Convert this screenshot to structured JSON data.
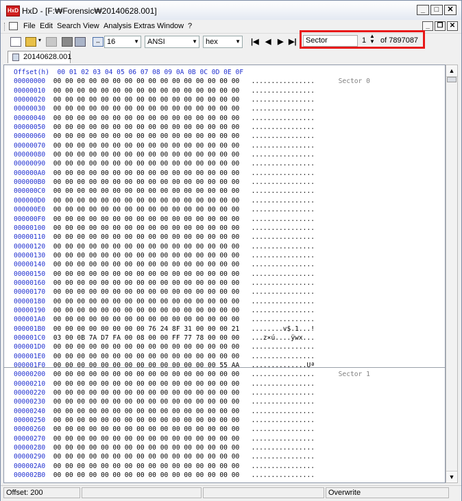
{
  "window": {
    "title": "HxD - [F:₩Forensic₩20140628.001]",
    "app_icon_text": "HxD"
  },
  "menu": [
    "File",
    "Edit",
    "Search",
    "View",
    "Analysis",
    "Extras",
    "Window",
    "?"
  ],
  "toolbar": {
    "bytes_per_row": "16",
    "charset": "ANSI",
    "offset_base": "hex",
    "sector_label": "Sector",
    "sector_value": "1",
    "sector_total": "of 7897087"
  },
  "tab": {
    "label": "20140628.001"
  },
  "hex": {
    "header": "Offset(h)  00 01 02 03 04 05 06 07 08 09 0A 0B 0C 0D 0E 0F",
    "rows": [
      {
        "o": "00000000",
        "b": "00 00 00 00 00 00 00 00 00 00 00 00 00 00 00 00",
        "t": "................",
        "s": "Sector 0"
      },
      {
        "o": "00000010",
        "b": "00 00 00 00 00 00 00 00 00 00 00 00 00 00 00 00",
        "t": "................",
        "s": ""
      },
      {
        "o": "00000020",
        "b": "00 00 00 00 00 00 00 00 00 00 00 00 00 00 00 00",
        "t": "................",
        "s": ""
      },
      {
        "o": "00000030",
        "b": "00 00 00 00 00 00 00 00 00 00 00 00 00 00 00 00",
        "t": "................",
        "s": ""
      },
      {
        "o": "00000040",
        "b": "00 00 00 00 00 00 00 00 00 00 00 00 00 00 00 00",
        "t": "................",
        "s": ""
      },
      {
        "o": "00000050",
        "b": "00 00 00 00 00 00 00 00 00 00 00 00 00 00 00 00",
        "t": "................",
        "s": ""
      },
      {
        "o": "00000060",
        "b": "00 00 00 00 00 00 00 00 00 00 00 00 00 00 00 00",
        "t": "................",
        "s": ""
      },
      {
        "o": "00000070",
        "b": "00 00 00 00 00 00 00 00 00 00 00 00 00 00 00 00",
        "t": "................",
        "s": ""
      },
      {
        "o": "00000080",
        "b": "00 00 00 00 00 00 00 00 00 00 00 00 00 00 00 00",
        "t": "................",
        "s": ""
      },
      {
        "o": "00000090",
        "b": "00 00 00 00 00 00 00 00 00 00 00 00 00 00 00 00",
        "t": "................",
        "s": ""
      },
      {
        "o": "000000A0",
        "b": "00 00 00 00 00 00 00 00 00 00 00 00 00 00 00 00",
        "t": "................",
        "s": ""
      },
      {
        "o": "000000B0",
        "b": "00 00 00 00 00 00 00 00 00 00 00 00 00 00 00 00",
        "t": "................",
        "s": ""
      },
      {
        "o": "000000C0",
        "b": "00 00 00 00 00 00 00 00 00 00 00 00 00 00 00 00",
        "t": "................",
        "s": ""
      },
      {
        "o": "000000D0",
        "b": "00 00 00 00 00 00 00 00 00 00 00 00 00 00 00 00",
        "t": "................",
        "s": ""
      },
      {
        "o": "000000E0",
        "b": "00 00 00 00 00 00 00 00 00 00 00 00 00 00 00 00",
        "t": "................",
        "s": ""
      },
      {
        "o": "000000F0",
        "b": "00 00 00 00 00 00 00 00 00 00 00 00 00 00 00 00",
        "t": "................",
        "s": ""
      },
      {
        "o": "00000100",
        "b": "00 00 00 00 00 00 00 00 00 00 00 00 00 00 00 00",
        "t": "................",
        "s": ""
      },
      {
        "o": "00000110",
        "b": "00 00 00 00 00 00 00 00 00 00 00 00 00 00 00 00",
        "t": "................",
        "s": ""
      },
      {
        "o": "00000120",
        "b": "00 00 00 00 00 00 00 00 00 00 00 00 00 00 00 00",
        "t": "................",
        "s": ""
      },
      {
        "o": "00000130",
        "b": "00 00 00 00 00 00 00 00 00 00 00 00 00 00 00 00",
        "t": "................",
        "s": ""
      },
      {
        "o": "00000140",
        "b": "00 00 00 00 00 00 00 00 00 00 00 00 00 00 00 00",
        "t": "................",
        "s": ""
      },
      {
        "o": "00000150",
        "b": "00 00 00 00 00 00 00 00 00 00 00 00 00 00 00 00",
        "t": "................",
        "s": ""
      },
      {
        "o": "00000160",
        "b": "00 00 00 00 00 00 00 00 00 00 00 00 00 00 00 00",
        "t": "................",
        "s": ""
      },
      {
        "o": "00000170",
        "b": "00 00 00 00 00 00 00 00 00 00 00 00 00 00 00 00",
        "t": "................",
        "s": ""
      },
      {
        "o": "00000180",
        "b": "00 00 00 00 00 00 00 00 00 00 00 00 00 00 00 00",
        "t": "................",
        "s": ""
      },
      {
        "o": "00000190",
        "b": "00 00 00 00 00 00 00 00 00 00 00 00 00 00 00 00",
        "t": "................",
        "s": ""
      },
      {
        "o": "000001A0",
        "b": "00 00 00 00 00 00 00 00 00 00 00 00 00 00 00 00",
        "t": "................",
        "s": ""
      },
      {
        "o": "000001B0",
        "b": "00 00 00 00 00 00 00 00 76 24 8F 31 00 00 00 21",
        "t": "........v$.1...!",
        "s": ""
      },
      {
        "o": "000001C0",
        "b": "03 00 0B 7A D7 FA 00 08 00 00 FF 77 78 00 00 00",
        "t": "...z×ú....ÿwx...",
        "s": ""
      },
      {
        "o": "000001D0",
        "b": "00 00 00 00 00 00 00 00 00 00 00 00 00 00 00 00",
        "t": "................",
        "s": ""
      },
      {
        "o": "000001E0",
        "b": "00 00 00 00 00 00 00 00 00 00 00 00 00 00 00 00",
        "t": "................",
        "s": ""
      },
      {
        "o": "000001F0",
        "b": "00 00 00 00 00 00 00 00 00 00 00 00 00 00 55 AA",
        "t": "..............Uª",
        "s": ""
      },
      {
        "o": "00000200",
        "b": "00 00 00 00 00 00 00 00 00 00 00 00 00 00 00 00",
        "t": "................",
        "s": "Sector 1"
      },
      {
        "o": "00000210",
        "b": "00 00 00 00 00 00 00 00 00 00 00 00 00 00 00 00",
        "t": "................",
        "s": ""
      },
      {
        "o": "00000220",
        "b": "00 00 00 00 00 00 00 00 00 00 00 00 00 00 00 00",
        "t": "................",
        "s": ""
      },
      {
        "o": "00000230",
        "b": "00 00 00 00 00 00 00 00 00 00 00 00 00 00 00 00",
        "t": "................",
        "s": ""
      },
      {
        "o": "00000240",
        "b": "00 00 00 00 00 00 00 00 00 00 00 00 00 00 00 00",
        "t": "................",
        "s": ""
      },
      {
        "o": "00000250",
        "b": "00 00 00 00 00 00 00 00 00 00 00 00 00 00 00 00",
        "t": "................",
        "s": ""
      },
      {
        "o": "00000260",
        "b": "00 00 00 00 00 00 00 00 00 00 00 00 00 00 00 00",
        "t": "................",
        "s": ""
      },
      {
        "o": "00000270",
        "b": "00 00 00 00 00 00 00 00 00 00 00 00 00 00 00 00",
        "t": "................",
        "s": ""
      },
      {
        "o": "00000280",
        "b": "00 00 00 00 00 00 00 00 00 00 00 00 00 00 00 00",
        "t": "................",
        "s": ""
      },
      {
        "o": "00000290",
        "b": "00 00 00 00 00 00 00 00 00 00 00 00 00 00 00 00",
        "t": "................",
        "s": ""
      },
      {
        "o": "000002A0",
        "b": "00 00 00 00 00 00 00 00 00 00 00 00 00 00 00 00",
        "t": "................",
        "s": ""
      },
      {
        "o": "000002B0",
        "b": "00 00 00 00 00 00 00 00 00 00 00 00 00 00 00 00",
        "t": "................",
        "s": ""
      }
    ]
  },
  "status": {
    "offset": "Offset: 200",
    "mode": "Overwrite"
  },
  "colors": {
    "highlight": "#e81818",
    "offset_text": "#2030d0",
    "sector_text": "#808080"
  }
}
